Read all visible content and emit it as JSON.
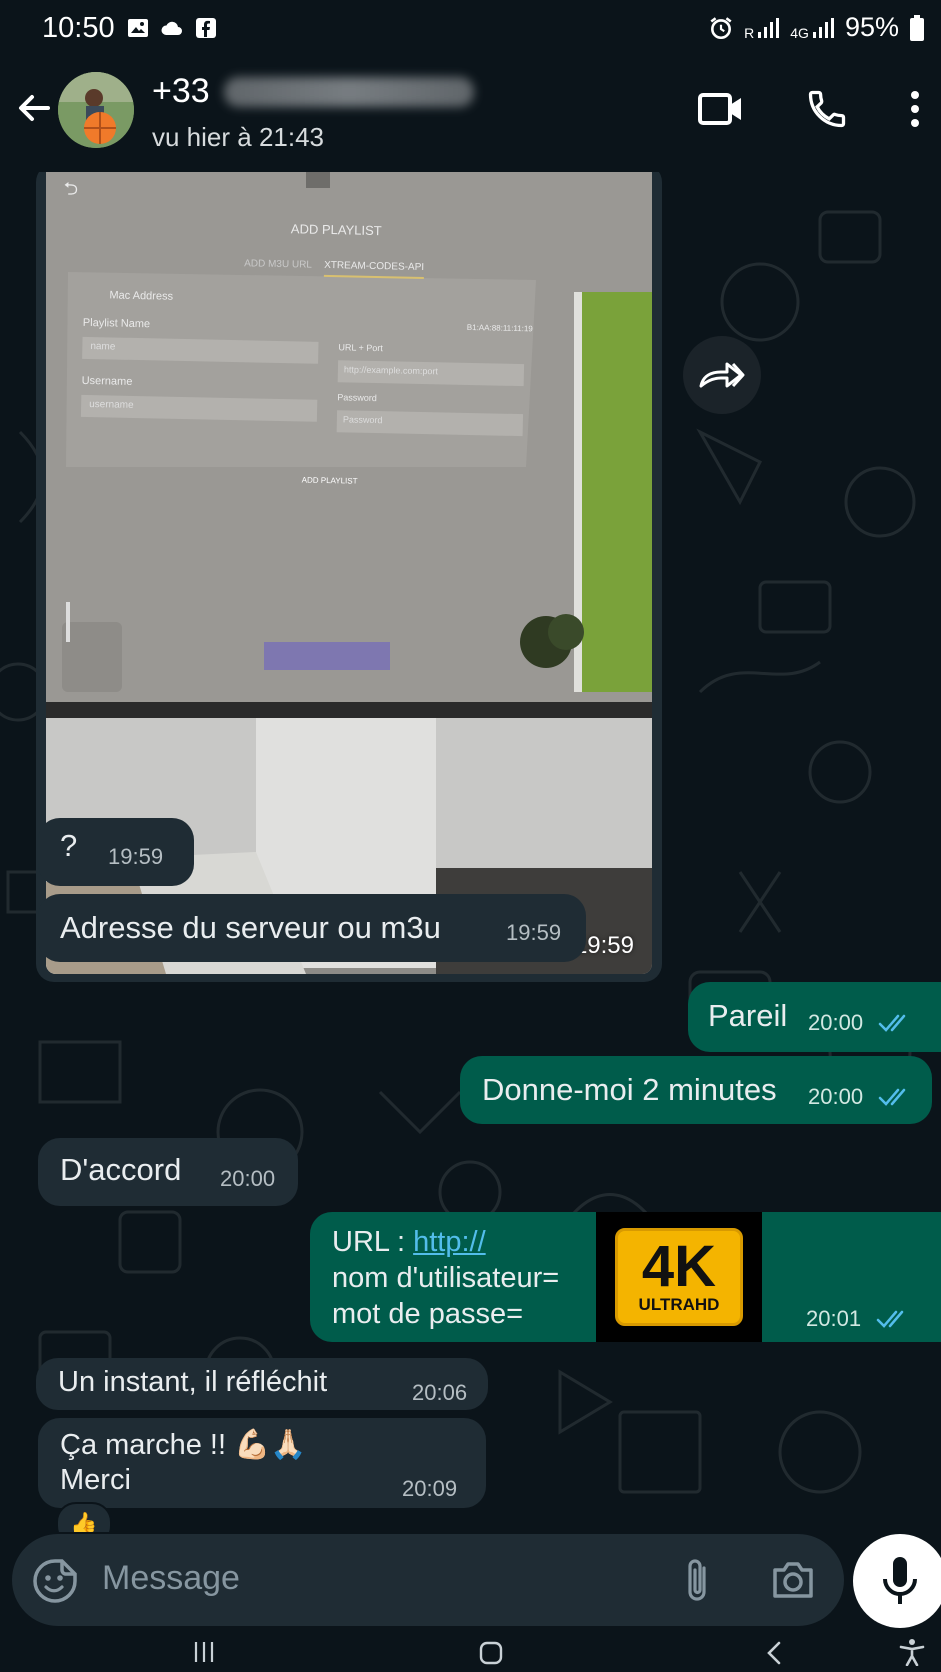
{
  "status_bar": {
    "time": "10:50",
    "battery": "95%",
    "signal_labels": [
      "R",
      "4G"
    ]
  },
  "header": {
    "contact_number": "+33",
    "last_seen": "vu hier à 21:43"
  },
  "photo_message": {
    "time": "19:59",
    "screen": {
      "title": "ADD PLAYLIST",
      "tab_m3u": "ADD M3U URL",
      "tab_xtream": "XTREAM-CODES-API",
      "mac_label": "Mac Address",
      "mac_value": "B1:AA:88:11:11:19",
      "playlist_name_label": "Playlist Name",
      "playlist_name_placeholder": "name",
      "url_port_label": "URL + Port",
      "url_port_placeholder": "http://example.com:port",
      "username_label": "Username",
      "username_placeholder": "username",
      "password_label": "Password",
      "password_placeholder": "Password",
      "button": "ADD PLAYLIST"
    }
  },
  "messages": [
    {
      "dir": "in",
      "text": "?",
      "time": "19:59"
    },
    {
      "dir": "in",
      "text": "Adresse du serveur ou m3u",
      "time": "19:59"
    },
    {
      "dir": "out",
      "text": "Pareil",
      "time": "20:00"
    },
    {
      "dir": "out",
      "text": "Donne-moi 2 minutes",
      "time": "20:00"
    },
    {
      "dir": "in",
      "text": "D'accord",
      "time": "20:00"
    },
    {
      "dir": "out",
      "url_prefix": "URL : ",
      "url_link": "http://",
      "line2": "nom d'utilisateur=",
      "line3": "mot de passe=",
      "preview_big": "4K",
      "preview_small": "ULTRAHD",
      "time": "20:01"
    },
    {
      "dir": "in",
      "text": "Un instant, il réfléchit",
      "time": "20:06"
    },
    {
      "dir": "in",
      "line1": "Ça marche !! 💪🏻🙏🏻",
      "line2": "Merci",
      "time": "20:09",
      "reaction": "👍"
    }
  ],
  "composer": {
    "placeholder": "Message"
  }
}
